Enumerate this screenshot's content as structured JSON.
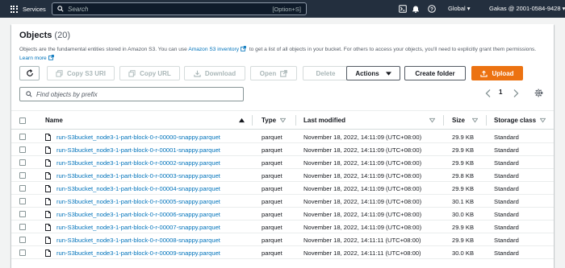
{
  "nav": {
    "services_label": "Services",
    "search_placeholder": "Search",
    "search_shortcut": "[Option+S]",
    "region_label": "Global",
    "account_label": "Gakas @ 2001-0584-9428"
  },
  "panel": {
    "title": "Objects",
    "count": "(20)",
    "desc_prefix": "Objects are the fundamental entities stored in Amazon S3. You can use",
    "desc_link": "Amazon S3 inventory",
    "desc_suffix": "to get a list of all objects in your bucket. For others to access your objects, you'll need to explicitly grant them permissions.",
    "learn_more": "Learn more"
  },
  "toolbar": {
    "refresh_label": "",
    "copy_s3_uri": "Copy S3 URI",
    "copy_url": "Copy URL",
    "download": "Download",
    "open": "Open",
    "delete": "Delete",
    "actions": "Actions",
    "create_folder": "Create folder",
    "upload": "Upload"
  },
  "filter": {
    "placeholder": "Find objects by prefix"
  },
  "pagination": {
    "current_page": "1"
  },
  "table": {
    "columns": {
      "name": "Name",
      "type": "Type",
      "last_modified": "Last modified",
      "size": "Size",
      "storage_class": "Storage class"
    },
    "rows": [
      {
        "name": "run-S3bucket_node3-1-part-block-0-r-00000-snappy.parquet",
        "type": "parquet",
        "last_modified": "November 18, 2022, 14:11:09 (UTC+08:00)",
        "size": "29.9 KB",
        "storage_class": "Standard"
      },
      {
        "name": "run-S3bucket_node3-1-part-block-0-r-00001-snappy.parquet",
        "type": "parquet",
        "last_modified": "November 18, 2022, 14:11:09 (UTC+08:00)",
        "size": "29.9 KB",
        "storage_class": "Standard"
      },
      {
        "name": "run-S3bucket_node3-1-part-block-0-r-00002-snappy.parquet",
        "type": "parquet",
        "last_modified": "November 18, 2022, 14:11:09 (UTC+08:00)",
        "size": "29.9 KB",
        "storage_class": "Standard"
      },
      {
        "name": "run-S3bucket_node3-1-part-block-0-r-00003-snappy.parquet",
        "type": "parquet",
        "last_modified": "November 18, 2022, 14:11:09 (UTC+08:00)",
        "size": "29.8 KB",
        "storage_class": "Standard"
      },
      {
        "name": "run-S3bucket_node3-1-part-block-0-r-00004-snappy.parquet",
        "type": "parquet",
        "last_modified": "November 18, 2022, 14:11:09 (UTC+08:00)",
        "size": "29.9 KB",
        "storage_class": "Standard"
      },
      {
        "name": "run-S3bucket_node3-1-part-block-0-r-00005-snappy.parquet",
        "type": "parquet",
        "last_modified": "November 18, 2022, 14:11:09 (UTC+08:00)",
        "size": "30.1 KB",
        "storage_class": "Standard"
      },
      {
        "name": "run-S3bucket_node3-1-part-block-0-r-00006-snappy.parquet",
        "type": "parquet",
        "last_modified": "November 18, 2022, 14:11:09 (UTC+08:00)",
        "size": "30.0 KB",
        "storage_class": "Standard"
      },
      {
        "name": "run-S3bucket_node3-1-part-block-0-r-00007-snappy.parquet",
        "type": "parquet",
        "last_modified": "November 18, 2022, 14:11:09 (UTC+08:00)",
        "size": "29.9 KB",
        "storage_class": "Standard"
      },
      {
        "name": "run-S3bucket_node3-1-part-block-0-r-00008-snappy.parquet",
        "type": "parquet",
        "last_modified": "November 18, 2022, 14:11:11 (UTC+08:00)",
        "size": "29.9 KB",
        "storage_class": "Standard"
      },
      {
        "name": "run-S3bucket_node3-1-part-block-0-r-00009-snappy.parquet",
        "type": "parquet",
        "last_modified": "November 18, 2022, 14:11:11 (UTC+08:00)",
        "size": "30.0 KB",
        "storage_class": "Standard"
      }
    ]
  },
  "colors": {
    "nav_bg": "#232f3e",
    "link": "#0073bb",
    "primary": "#ec7211"
  },
  "icons": [
    "grid-icon",
    "search-icon",
    "terminal-icon",
    "bell-icon",
    "help-icon",
    "refresh-icon",
    "copy-icon",
    "download-icon",
    "external-link-icon",
    "chevron-down-icon",
    "upload-icon",
    "chevron-left-icon",
    "chevron-right-icon",
    "gear-icon",
    "sort-icon",
    "file-icon"
  ]
}
